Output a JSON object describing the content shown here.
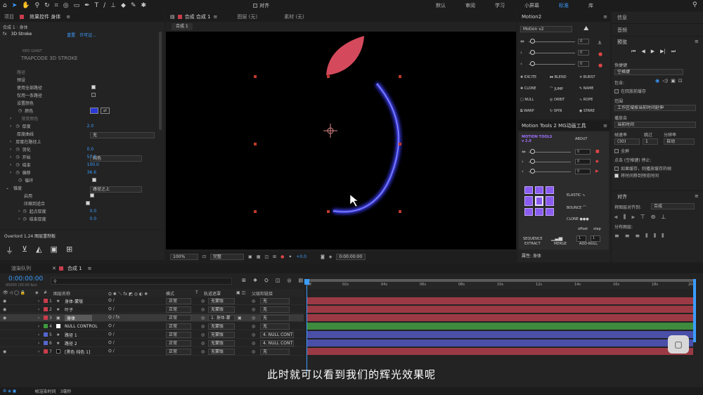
{
  "top_workspaces": [
    "默认",
    "审阅",
    "学习",
    "小屏幕",
    "标准",
    "库"
  ],
  "top_align_label": "对齐",
  "project_panel": {
    "tabs": [
      "项目",
      "效果控件 身体"
    ],
    "layer_path": "合成 1 · 身体",
    "effect_name": "3D Stroke",
    "reset_label": "重置",
    "about_label": "许可证...",
    "brand_line1": "RED GIANT",
    "brand_line2": "TRAPCODE 3D STROKE",
    "params": [
      {
        "label": "路径",
        "value": ""
      },
      {
        "label": "预设",
        "value": "无"
      },
      {
        "label": "使用全部路径",
        "value": "checked"
      },
      {
        "label": "仅用一条路径",
        "value": "unchecked"
      },
      {
        "label": "设置颜色",
        "value": "纯色"
      },
      {
        "label": "颜色",
        "value": "color"
      },
      {
        "label": "渐变颜色",
        "value": ""
      },
      {
        "label": "厚度",
        "value": "2.0"
      },
      {
        "label": "厚度曲线",
        "value": "路径之上"
      },
      {
        "label": "厚度在路径上",
        "value": ""
      },
      {
        "label": "羽化",
        "value": "0.0"
      },
      {
        "label": "开始",
        "value": "57.5"
      },
      {
        "label": "结束",
        "value": "100.0"
      },
      {
        "label": "偏移",
        "value": "36.6"
      },
      {
        "label": "循环",
        "value": "checked"
      },
      {
        "label": "锥度",
        "value": ""
      },
      {
        "label": "启用",
        "value": "checked"
      },
      {
        "label": "压缩到适合",
        "value": "checked"
      },
      {
        "label": "起点厚度",
        "value": "0.0"
      },
      {
        "label": "结束厚度",
        "value": "0.0"
      }
    ],
    "color_hex": "#2b39d6"
  },
  "overlord_panel": {
    "title": "Overlord 1.24 图层重制板"
  },
  "composition": {
    "tab": "合成 合成 1",
    "layer_tab": "图层 (无)",
    "footage_tab": "素材 (无)",
    "breadcrumb": "合成 1",
    "zoom": "100%",
    "quality": "完整",
    "exposure": "+0.0",
    "timecode": "0:00:00:00",
    "leaf_color": "#d44a5c",
    "stroke_color": "#3a3ad8"
  },
  "motion2": {
    "title": "Motion2",
    "version": "Motion v2",
    "slider_values": [
      "0",
      "0",
      "0"
    ],
    "buttons": [
      "EXCITE",
      "BLEND",
      "BURST",
      "CLONE",
      "JUMP",
      "NAME",
      "NULL",
      "ORBIT",
      "ROPE",
      "WARP",
      "SPIN",
      "STARE"
    ]
  },
  "motion_tools": {
    "title": "Motion Tools 2 MG动画工具",
    "logo": "MOTION TOOLS v 2.0",
    "about": "ABOUT",
    "values": [
      "0",
      "0",
      "0"
    ],
    "elastic": "ELASTIC",
    "bounce": "BOUNCE",
    "clone": "CLONE",
    "offset": "offset",
    "step": "step",
    "sequence": "SEQUENCE",
    "seq_values": [
      "1",
      "1"
    ],
    "extract": "EXTRACT",
    "merge": "MERGE",
    "add_null": "ADD-NULL",
    "property_label": "属性: 身体"
  },
  "right_panel": {
    "tabs": [
      "信息",
      "音频",
      "预览"
    ],
    "shortcut_label": "快捷键",
    "shortcut_value": "空格键",
    "include_label": "包含:",
    "cache_label": "在回放前缓存",
    "range_label": "范围",
    "range_value": "工作区域按当前时间延伸",
    "play_from_label": "播放自",
    "play_from_value": "当前时间",
    "frame_rate_label": "帧速率",
    "skip_label": "跳过",
    "resolution_label": "分辨率",
    "frame_rate_value": "(30)",
    "skip_value": "1",
    "resolution_value": "自动",
    "fullscreen_label": "全屏",
    "stop_label": "点击 (空格键) 停止:",
    "stop_opt1": "如果缓存，则播放缓存的帧",
    "stop_opt2": "将时间移到预览时间",
    "align_title": "对齐",
    "align_to_label": "将图层对齐到:",
    "align_to_value": "合成",
    "distribute_label": "分布图层:"
  },
  "timeline": {
    "tabs": [
      "渲染队列",
      "合成 1"
    ],
    "timecode": "0:00:00:00",
    "timecode_sub": "00000 (30.00 fps)",
    "search_placeholder": "",
    "col_name": "图层名称",
    "col_mode": "模式",
    "col_t": "T",
    "col_trkmat": "轨道遮罩",
    "col_parent": "父级和链接",
    "ruler": [
      "0f",
      "02s",
      "04s",
      "06s",
      "08s",
      "10s",
      "12s",
      "14s",
      "16s",
      "18s",
      "20s"
    ],
    "layers": [
      {
        "num": "1",
        "name": "身体-蒙版",
        "color": "#c93d4d",
        "mode": "正常",
        "mat": "无蒙版",
        "parent": "无",
        "bar": "#9b3a44"
      },
      {
        "num": "2",
        "name": "叶子",
        "color": "#c93d4d",
        "mode": "正常",
        "mat": "无蒙版",
        "parent": "无",
        "bar": "#9b3a44"
      },
      {
        "num": "3",
        "name": "身体",
        "color": "#c93d4d",
        "mode": "正常",
        "mat": "1. 身体-蒙",
        "parent": "无",
        "bar": "#9b3a44"
      },
      {
        "num": "4",
        "name": "NULL CONTROL",
        "color": "#ffffff",
        "mode": "正常",
        "mat": "无蒙版",
        "parent": "无",
        "bar": "#3e8a3e"
      },
      {
        "num": "5",
        "name": "路径 1",
        "color": "#5566cc",
        "mode": "正常",
        "mat": "无蒙版",
        "parent": "4. NULL CONT",
        "bar": "#4a4fa8"
      },
      {
        "num": "6",
        "name": "路径 2",
        "color": "#5566cc",
        "mode": "正常",
        "mat": "无蒙版",
        "parent": "4. NULL CONT",
        "bar": "#4a4fa8"
      },
      {
        "num": "7",
        "name": "[黑色 纯色 1]",
        "color": "#c93d4d",
        "mode": "正常",
        "mat": "无蒙版",
        "parent": "无",
        "bar": "#9b3a44"
      }
    ]
  },
  "status_bar": {
    "render_label": "帧渲染时间",
    "render_value": "3毫秒"
  },
  "subtitle": "此时就可以看到我们的辉光效果呢"
}
